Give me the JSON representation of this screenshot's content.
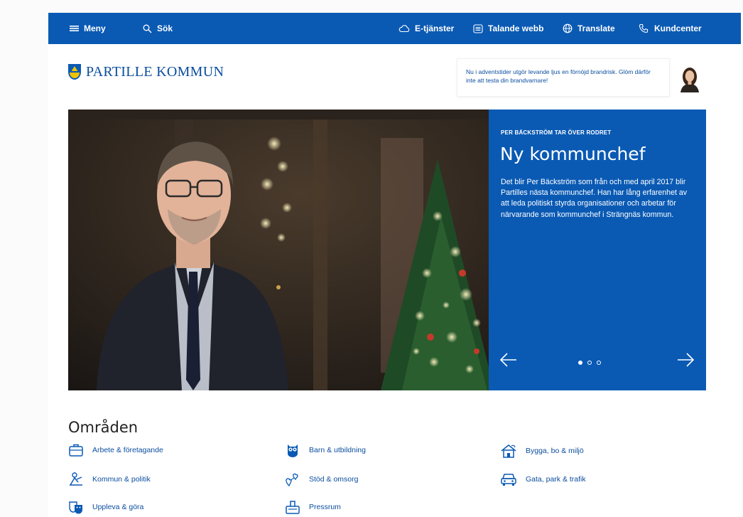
{
  "topbar": {
    "menu_label": "Meny",
    "search_label": "Sök",
    "eservices_label": "E-tjänster",
    "speaking_web_label": "Talande webb",
    "translate_label": "Translate",
    "customer_center_label": "Kundcenter"
  },
  "header": {
    "logo_text": "PARTILLE KOMMUN",
    "tip_text": "Nu i adventstider utgör levande ljus en förnöjd brandrisk. Glöm därför inte att testa din brandvarnare!"
  },
  "hero": {
    "kicker": "PER BÄCKSTRÖM TAR ÖVER RODRET",
    "title": "Ny kommunchef",
    "body": "Det blir Per Bäckström som från och med april 2017 blir Partilles nästa kommunchef. Han har lång erfarenhet av att leda politiskt styrda organisationer och arbetar för närvarande som kommunchef i Strängnäs kommun.",
    "slide_count": 3,
    "active_slide": 1
  },
  "areas": {
    "title": "Områden",
    "items": [
      {
        "label": "Arbete & företagande",
        "icon": "briefcase-icon"
      },
      {
        "label": "Barn & utbildning",
        "icon": "owl-icon"
      },
      {
        "label": "Bygga, bo & miljö",
        "icon": "house-icon"
      },
      {
        "label": "Kommun & politik",
        "icon": "people-icon"
      },
      {
        "label": "Stöd & omsorg",
        "icon": "hearts-icon"
      },
      {
        "label": "Gata, park & trafik",
        "icon": "car-icon"
      },
      {
        "label": "Uppleva & göra",
        "icon": "mask-icon"
      },
      {
        "label": "Pressrum",
        "icon": "press-icon"
      }
    ]
  },
  "colors": {
    "brand_blue": "#0a5ab4",
    "link_blue": "#0a4d9e"
  }
}
